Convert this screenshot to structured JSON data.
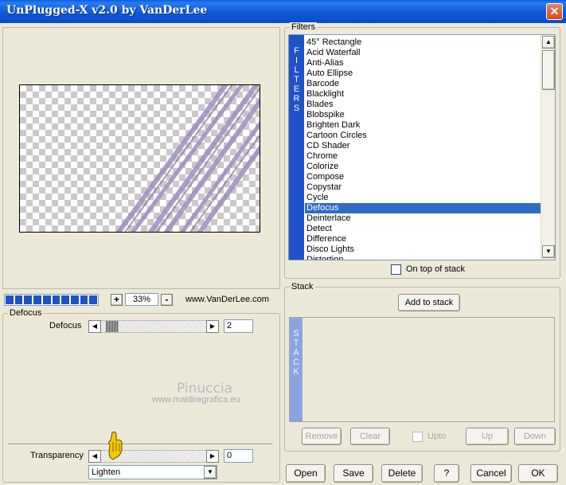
{
  "window": {
    "title": "UnPlugged-X v2.0 by VanDerLee",
    "close_glyph": "✕"
  },
  "preview": {
    "zoom_plus": "+",
    "zoom_minus": "-",
    "zoom_value": "33%",
    "website": "www.VanDerLee.com"
  },
  "progress": {
    "segments": 10
  },
  "parameters": {
    "group_label": "Defocus",
    "defocus_label": "Defocus",
    "defocus_value": "2",
    "transparency_label": "Transparency",
    "transparency_value": "0",
    "blend_mode": "Lighten",
    "left_arrow": "◀",
    "right_arrow": "▶",
    "dropdown_arrow": "▼"
  },
  "watermark": {
    "line1": "Pinuccia",
    "line2": "www.maidiregrafica.eu"
  },
  "filters": {
    "label": "Filters",
    "strip_letters": "F\nI\nL\nT\nE\nR\nS",
    "items": [
      "45° Rectangle",
      "Acid Waterfall",
      "Anti-Alias",
      "Auto Ellipse",
      "Barcode",
      "Blacklight",
      "Blades",
      "Blobspike",
      "Brighten Dark",
      "Cartoon Circles",
      "CD Shader",
      "Chrome",
      "Colorize",
      "Compose",
      "Copystar",
      "Cycle",
      "Defocus",
      "Deinterlace",
      "Detect",
      "Difference",
      "Disco Lights",
      "Distortion"
    ],
    "selected_index": 16,
    "on_top_label": "On top of stack",
    "scroll_up": "▲",
    "scroll_down": "▼"
  },
  "stack": {
    "label": "Stack",
    "add_button": "Add to stack",
    "strip_letters": "S\nT\nA\nC\nK",
    "remove": "Remove",
    "clear": "Clear",
    "upto": "Upto",
    "up": "Up",
    "down": "Down"
  },
  "footer": {
    "open": "Open",
    "save": "Save",
    "delete": "Delete",
    "help": "?",
    "cancel": "Cancel",
    "ok": "OK"
  },
  "colors": {
    "titlebar": "#0a5fe0",
    "selection": "#316ac5",
    "strip": "#1f51c8",
    "stack_strip": "#8aa4e0",
    "preview_stripes": "#a08cc0"
  }
}
